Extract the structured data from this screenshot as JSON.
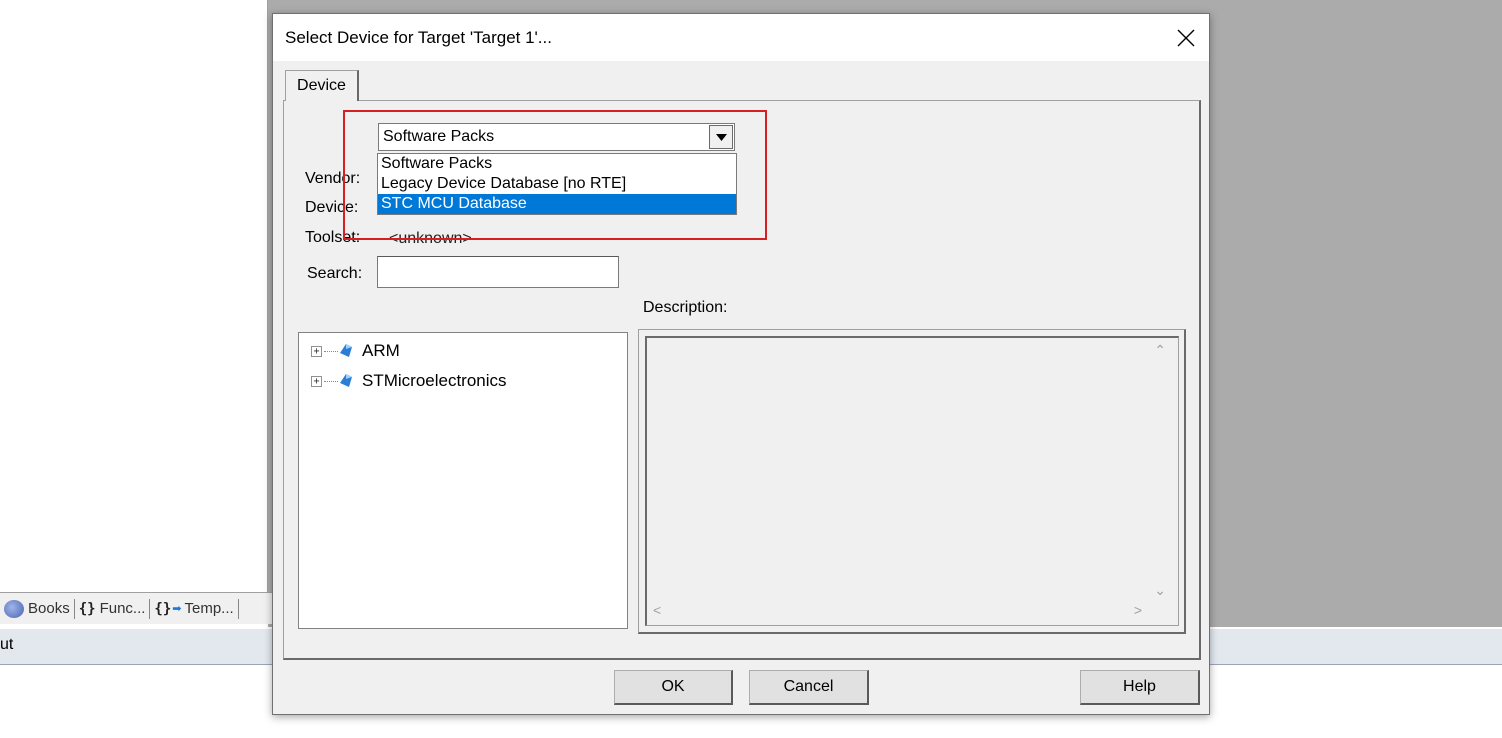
{
  "background": {
    "tabs": [
      {
        "label": "Books",
        "icon": "books-icon"
      },
      {
        "glyph": "{}",
        "label": "Func...",
        "icon": "functions-icon"
      },
      {
        "glyph": "{}",
        "label": "Temp...",
        "icon": "templates-icon"
      }
    ],
    "output_label": "ut"
  },
  "dialog": {
    "title": "Select Device for Target 'Target 1'...",
    "tab_label": "Device",
    "combo_value": "Software Packs",
    "dropdown_options": [
      "Software Packs",
      "Legacy Device Database [no RTE]",
      "STC MCU Database"
    ],
    "selected_option_index": 2,
    "vendor_label": "Vendor:",
    "device_label": "Device:",
    "toolset_label": "Toolset:",
    "toolset_value": "<unknown>",
    "search_label": "Search:",
    "search_value": "",
    "description_label": "Description:",
    "tree_items": [
      {
        "label": "ARM",
        "expander": "+"
      },
      {
        "label": "STMicroelectronics",
        "expander": "+"
      }
    ],
    "buttons": {
      "ok": "OK",
      "cancel": "Cancel",
      "help": "Help"
    },
    "colors": {
      "highlight_box": "#d42020",
      "selection": "#0078d7"
    }
  }
}
